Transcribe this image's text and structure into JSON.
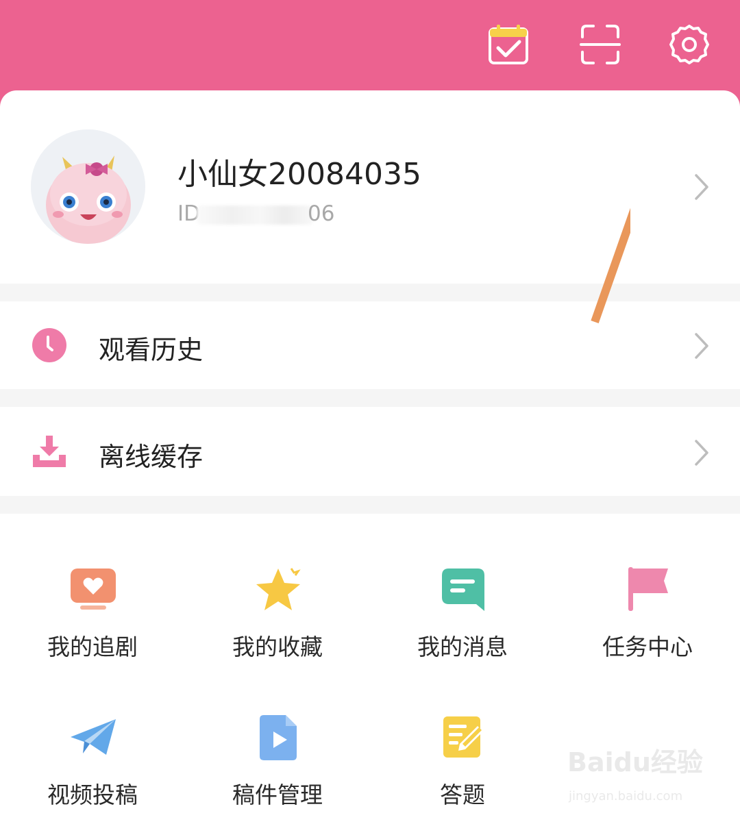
{
  "colors": {
    "header_bg": "#ec6290",
    "accent_pink": "#ef7ba8",
    "drama_orange": "#f2916f",
    "star_yellow": "#f7c843",
    "message_teal": "#4fbfa5",
    "flag_pink": "#ee88ad",
    "plane_blue": "#62a8e9",
    "video_blue": "#7cb1ef",
    "quiz_yellow": "#f6cf48",
    "annotation_arrow": "#e9975a"
  },
  "header": {
    "icons": [
      "calendar-check-icon",
      "scan-icon",
      "gear-icon"
    ]
  },
  "profile": {
    "username": "小仙女20084035",
    "id_prefix": "ID",
    "id_suffix": "06"
  },
  "menu": {
    "history": {
      "label": "观看历史",
      "icon": "clock-icon"
    },
    "offline": {
      "label": "离线缓存",
      "icon": "download-icon"
    }
  },
  "grid": [
    {
      "label": "我的追剧",
      "icon": "tv-heart-icon"
    },
    {
      "label": "我的收藏",
      "icon": "star-icon"
    },
    {
      "label": "我的消息",
      "icon": "message-icon"
    },
    {
      "label": "任务中心",
      "icon": "flag-icon"
    },
    {
      "label": "视频投稿",
      "icon": "paper-plane-icon"
    },
    {
      "label": "稿件管理",
      "icon": "video-file-icon"
    },
    {
      "label": "答题",
      "icon": "quiz-edit-icon"
    }
  ],
  "watermark": {
    "logo": "Baidu经验",
    "url": "jingyan.baidu.com"
  }
}
